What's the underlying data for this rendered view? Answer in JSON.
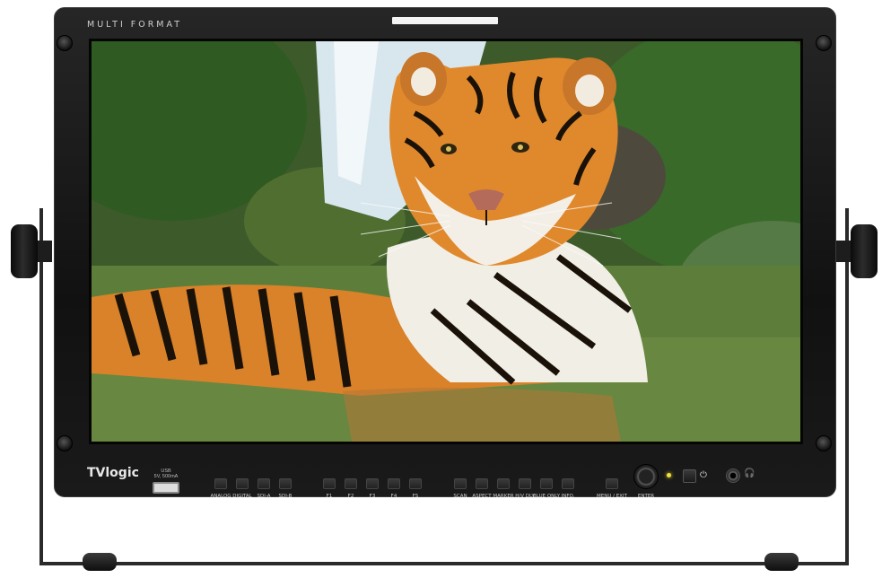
{
  "monitor": {
    "top_label": "MULTI FORMAT",
    "brand": "TVlogic",
    "usb_label_line1": "USB",
    "usb_label_line2": "5V, 500mA"
  },
  "screen": {
    "content_description_icon": "tiger-image"
  },
  "controls": {
    "input_buttons": [
      {
        "label": "ANALOG"
      },
      {
        "label": "DIGITAL"
      },
      {
        "label": "SDI-A"
      },
      {
        "label": "SDI-B"
      }
    ],
    "function_buttons": [
      {
        "label": "F1"
      },
      {
        "label": "F2"
      },
      {
        "label": "F3"
      },
      {
        "label": "F4"
      },
      {
        "label": "F5"
      }
    ],
    "mode_buttons": [
      {
        "label": "SCAN"
      },
      {
        "label": "ASPECT"
      },
      {
        "label": "MARKER"
      },
      {
        "label": "H/V DLY"
      },
      {
        "label": "BLUE ONLY"
      },
      {
        "label": "INFO."
      }
    ],
    "menu_label": "MENU / EXIT",
    "enter_label": "ENTER",
    "power_icon": "⏻",
    "headphone_icon": "🎧"
  },
  "colors": {
    "bezel": "#161616",
    "led": "#f4e23a"
  }
}
